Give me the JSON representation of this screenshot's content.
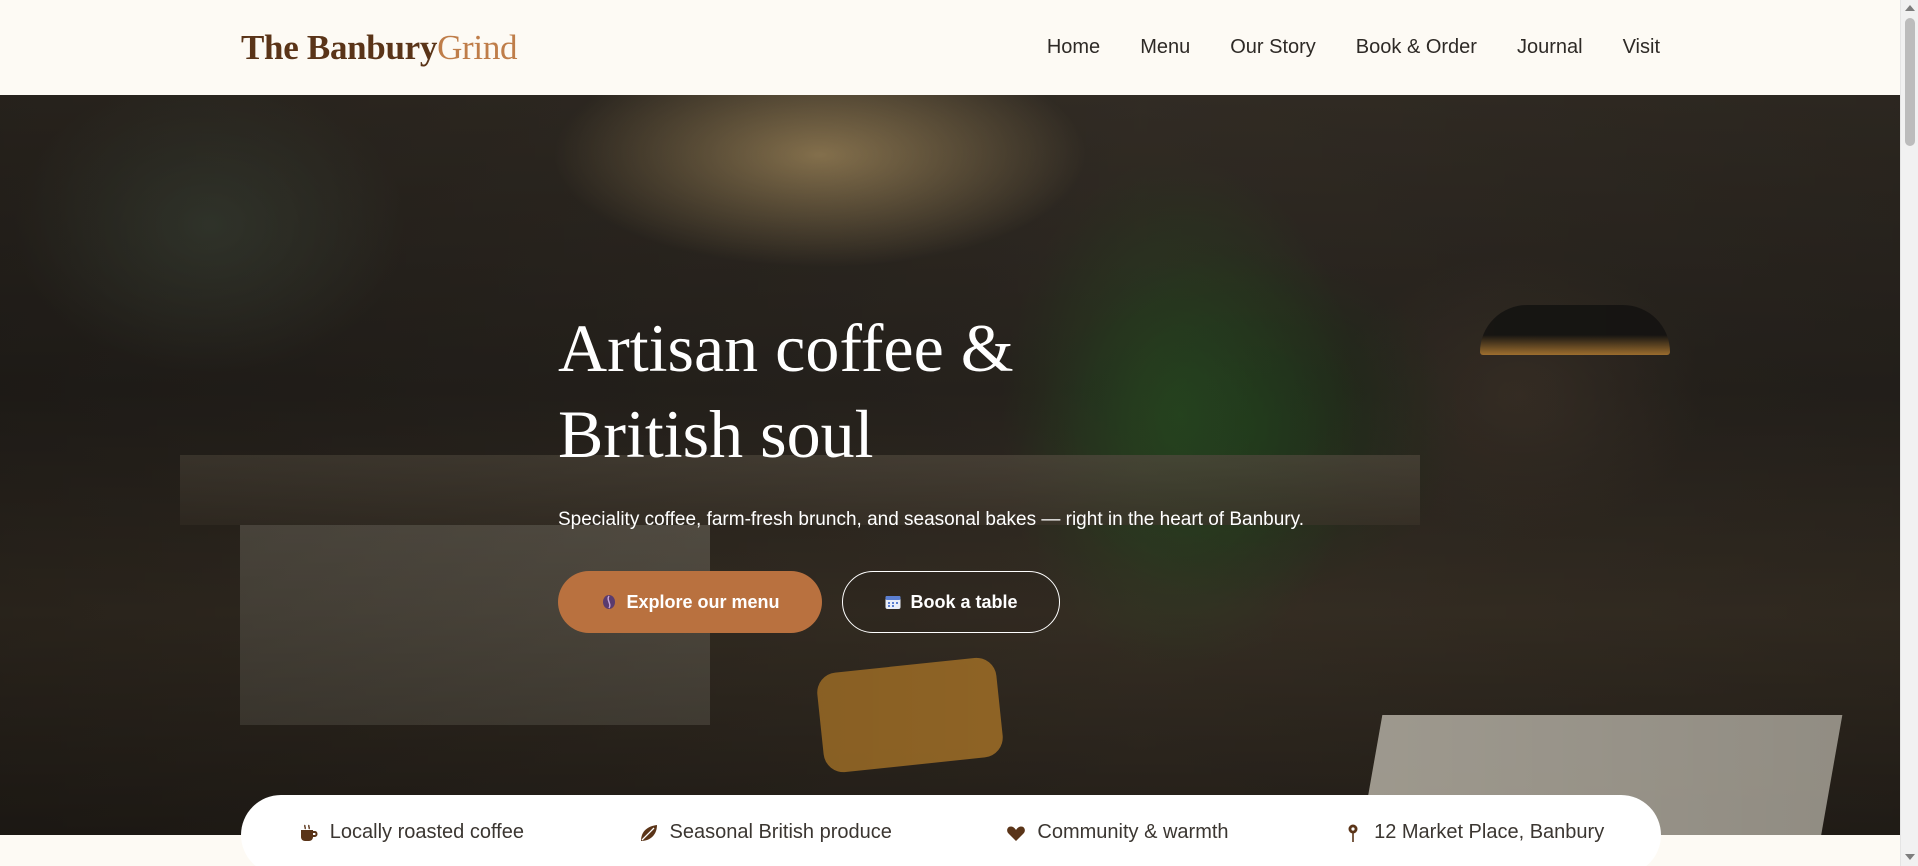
{
  "brand": {
    "part1": "The Banbury",
    "part2": "Grind"
  },
  "nav": {
    "items": [
      "Home",
      "Menu",
      "Our Story",
      "Book & Order",
      "Journal",
      "Visit"
    ]
  },
  "hero": {
    "title": "Artisan coffee & British soul",
    "subtitle": "Speciality coffee, farm-fresh brunch, and seasonal bakes — right in the heart of Banbury.",
    "primary_button": {
      "label": "Explore our menu",
      "icon": "coffee-bean-icon"
    },
    "secondary_button": {
      "label": "Book a table",
      "icon": "calendar-icon"
    }
  },
  "features": [
    {
      "label": "Locally roasted coffee",
      "icon": "coffee-cup-icon"
    },
    {
      "label": "Seasonal British produce",
      "icon": "leaf-icon"
    },
    {
      "label": "Community & warmth",
      "icon": "heart-icon"
    },
    {
      "label": "12 Market Place, Banbury",
      "icon": "map-pin-icon"
    }
  ],
  "colors": {
    "brand_dark": "#5a3418",
    "brand_accent": "#bf7d49",
    "primary_button": "#b9713f",
    "page_background": "#fdfaf4"
  }
}
